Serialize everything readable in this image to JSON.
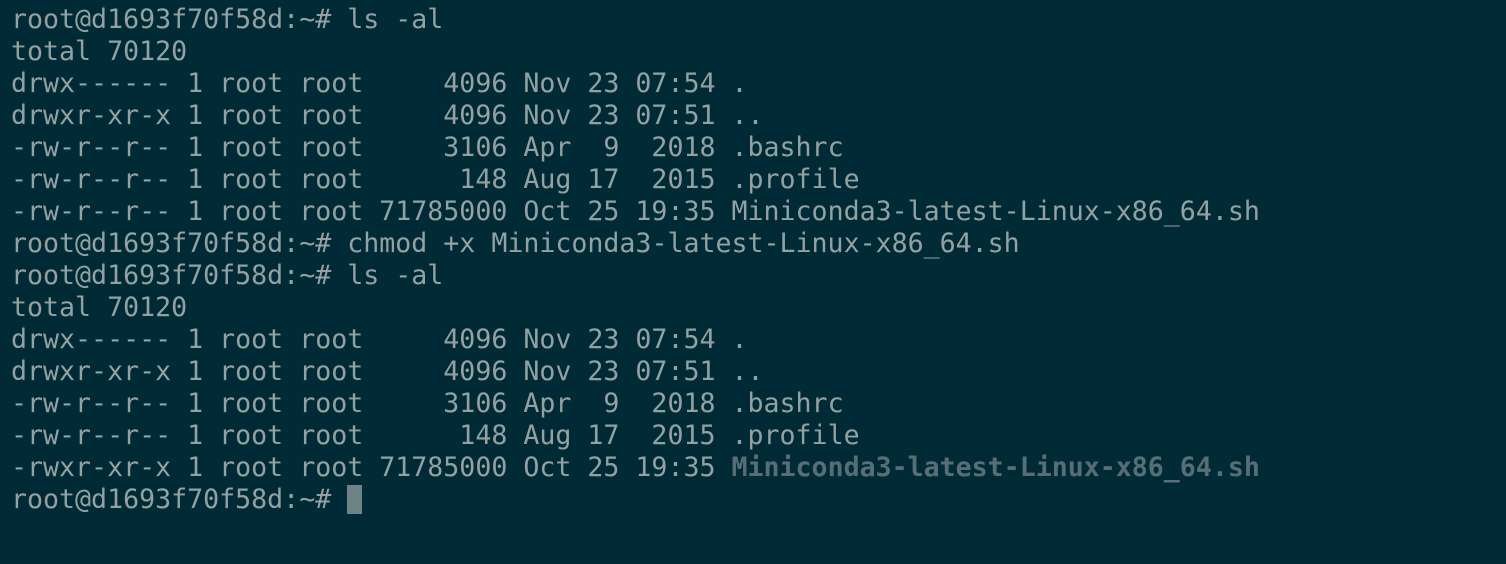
{
  "terminal": {
    "prompt": "root@d1693f70f58d:~# ",
    "colors": {
      "background": "#002b36",
      "foreground": "#93a1a1",
      "executable": "#586e75"
    },
    "cmd1": "ls -al",
    "total1": "total 70120",
    "listing1": [
      {
        "meta": "drwx------ 1 root root     4096 Nov 23 07:54 ",
        "name": "."
      },
      {
        "meta": "drwxr-xr-x 1 root root     4096 Nov 23 07:51 ",
        "name": ".."
      },
      {
        "meta": "-rw-r--r-- 1 root root     3106 Apr  9  2018 ",
        "name": ".bashrc"
      },
      {
        "meta": "-rw-r--r-- 1 root root      148 Aug 17  2015 ",
        "name": ".profile"
      },
      {
        "meta": "-rw-r--r-- 1 root root 71785000 Oct 25 19:35 ",
        "name": "Miniconda3-latest-Linux-x86_64.sh"
      }
    ],
    "cmd2": "chmod +x Miniconda3-latest-Linux-x86_64.sh",
    "cmd3": "ls -al",
    "total2": "total 70120",
    "listing2": [
      {
        "meta": "drwx------ 1 root root     4096 Nov 23 07:54 ",
        "name": "."
      },
      {
        "meta": "drwxr-xr-x 1 root root     4096 Nov 23 07:51 ",
        "name": ".."
      },
      {
        "meta": "-rw-r--r-- 1 root root     3106 Apr  9  2018 ",
        "name": ".bashrc"
      },
      {
        "meta": "-rw-r--r-- 1 root root      148 Aug 17  2015 ",
        "name": ".profile"
      },
      {
        "meta": "-rwxr-xr-x 1 root root 71785000 Oct 25 19:35 ",
        "name": "Miniconda3-latest-Linux-x86_64.sh"
      }
    ]
  }
}
